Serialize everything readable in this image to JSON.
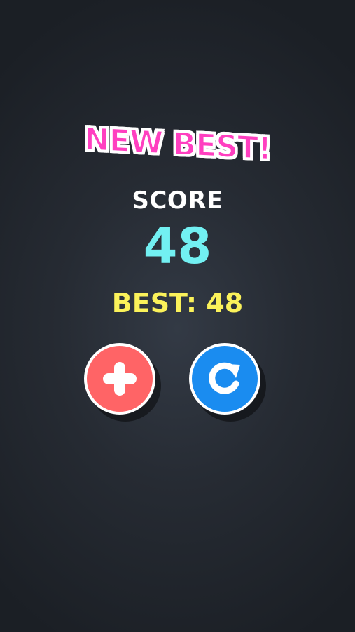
{
  "gameover": {
    "headline": "NEW BEST!",
    "score_label": "SCORE",
    "score_value": "48",
    "best_text": "BEST: 48"
  },
  "buttons": {
    "add": {
      "icon": "plus-icon",
      "color": "#ff6466"
    },
    "replay": {
      "icon": "replay-icon",
      "color": "#1a8cf0"
    }
  },
  "colors": {
    "headline": "#ff3fc0",
    "score": "#72f0f2",
    "best": "#fbf25a",
    "background": "#262b33"
  }
}
